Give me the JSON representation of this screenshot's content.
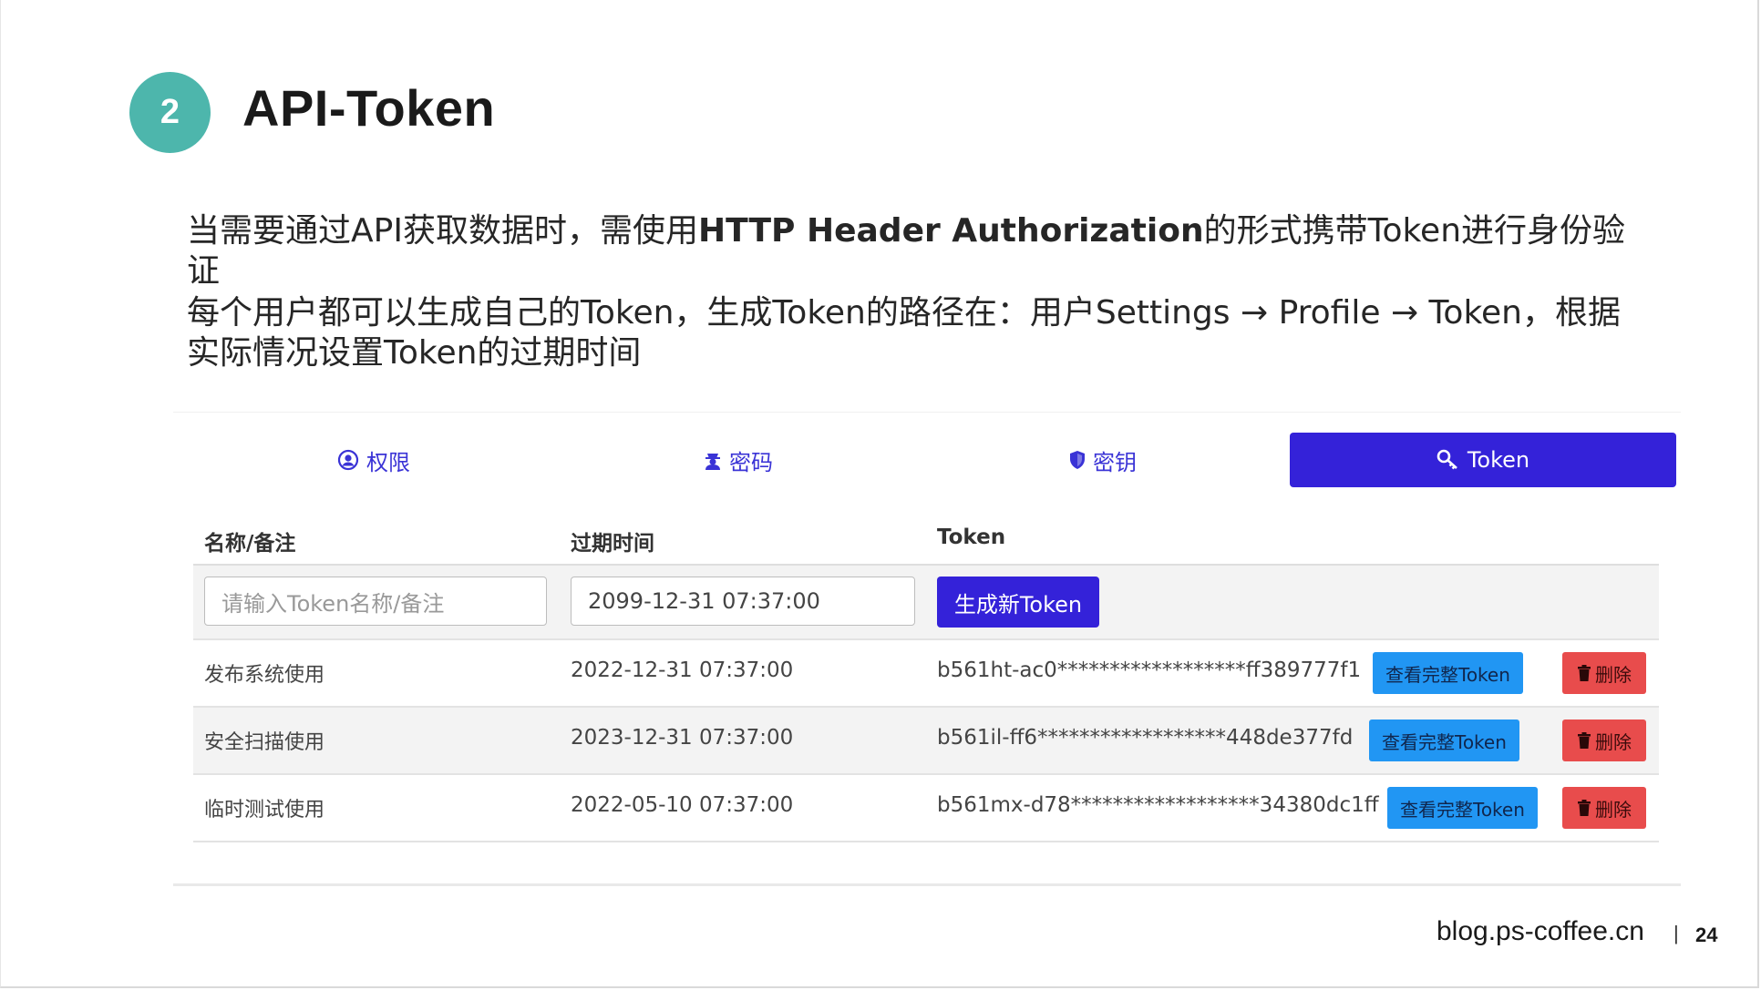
{
  "slide": {
    "number": "2",
    "title": "API-Token",
    "para1": {
      "prefix": "当需要通过API获取数据时，需使用",
      "bold": "HTTP Header Authorization",
      "suffix": "的形式携带Token进行身份验证"
    },
    "para2": "每个用户都可以生成自己的Token，生成Token的路径在：用户Settings → Profile → Token，根据实际情况设置Token的过期时间"
  },
  "tabs": [
    {
      "label": "权限",
      "icon": "user-circle-icon"
    },
    {
      "label": "密码",
      "icon": "user-secret-icon"
    },
    {
      "label": "密钥",
      "icon": "shield-icon"
    },
    {
      "label": "Token",
      "icon": "key-icon",
      "active": true
    }
  ],
  "table": {
    "headers": [
      "名称/备注",
      "过期时间",
      "Token"
    ],
    "new_row": {
      "name_placeholder": "请输入Token名称/备注",
      "expiry_value": "2099-12-31 07:37:00",
      "generate_label": "生成新Token"
    },
    "rows": [
      {
        "name": "发布系统使用",
        "expiry": "2022-12-31 07:37:00",
        "token": "b561ht-ac0******************ff389777f1"
      },
      {
        "name": "安全扫描使用",
        "expiry": "2023-12-31 07:37:00",
        "token": "b561il-ff6******************448de377fd"
      },
      {
        "name": "临时测试使用",
        "expiry": "2022-05-10 07:37:00",
        "token": "b561mx-d78******************34380dc1ff"
      }
    ],
    "view_label": "查看完整Token",
    "delete_label": "删除"
  },
  "footer": {
    "site": "blog.ps-coffee.cn",
    "separator": "|",
    "page": "24"
  },
  "colors": {
    "badge": "#4db6ac",
    "primary": "#3422d9",
    "view_button": "#2196f3",
    "delete_button": "#e84c4c"
  }
}
